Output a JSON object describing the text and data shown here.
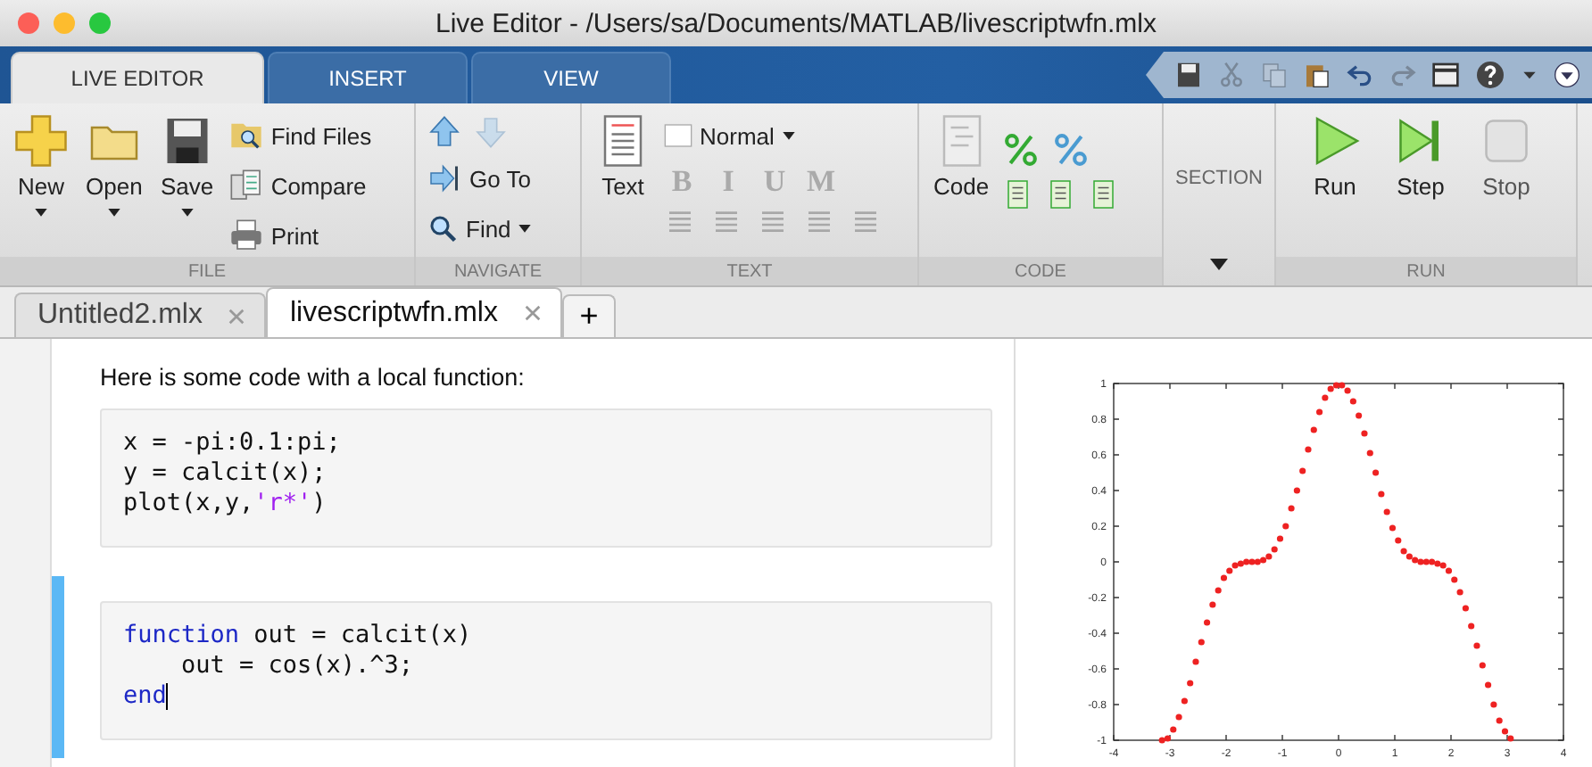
{
  "window": {
    "title": "Live Editor - /Users/sa/Documents/MATLAB/livescriptwfn.mlx"
  },
  "ribbon_tabs": [
    {
      "label": "LIVE EDITOR",
      "selected": true
    },
    {
      "label": "INSERT",
      "selected": false
    },
    {
      "label": "VIEW",
      "selected": false
    }
  ],
  "quick_access": [
    {
      "kind": "save",
      "disabled": false
    },
    {
      "kind": "cut",
      "disabled": true
    },
    {
      "kind": "copy",
      "disabled": true
    },
    {
      "kind": "paste",
      "disabled": false
    },
    {
      "kind": "undo",
      "disabled": false
    },
    {
      "kind": "redo",
      "disabled": true
    },
    {
      "kind": "window",
      "disabled": false
    },
    {
      "kind": "help",
      "disabled": false
    },
    {
      "kind": "caret",
      "disabled": false
    },
    {
      "kind": "menu",
      "disabled": false
    }
  ],
  "file_group": {
    "label": "FILE",
    "large": [
      {
        "kind": "new",
        "label": "New"
      },
      {
        "kind": "open",
        "label": "Open"
      },
      {
        "kind": "save",
        "label": "Save"
      }
    ],
    "small": [
      {
        "kind": "find",
        "label": "Find Files"
      },
      {
        "kind": "compare",
        "label": "Compare"
      },
      {
        "kind": "print",
        "label": "Print"
      }
    ]
  },
  "navigate_group": {
    "label": "NAVIGATE",
    "arrows": [
      {
        "kind": "up",
        "disabled": false
      },
      {
        "kind": "down",
        "disabled": true
      }
    ],
    "go_to": "Go To",
    "find": "Find"
  },
  "text_group": {
    "label": "TEXT",
    "button": "Text",
    "style": "Normal",
    "formats": [
      {
        "label": "B",
        "disabled": true
      },
      {
        "label": "I",
        "disabled": true
      },
      {
        "label": "U",
        "disabled": true
      },
      {
        "label": "M",
        "disabled": true
      }
    ]
  },
  "code_group": {
    "label": "CODE",
    "button": "Code"
  },
  "section_group": {
    "label": "SECTION"
  },
  "run_group": {
    "label": "RUN",
    "buttons": [
      {
        "kind": "run",
        "label": "Run",
        "disabled": false
      },
      {
        "kind": "step",
        "label": "Step",
        "disabled": false
      },
      {
        "kind": "stop",
        "label": "Stop",
        "disabled": true
      }
    ]
  },
  "doc_tabs": [
    {
      "label": "Untitled2.mlx",
      "selected": false
    },
    {
      "label": "livescriptwfn.mlx",
      "selected": true
    }
  ],
  "new_tab": "+",
  "document": {
    "text": "Here is some code with a local function:",
    "blocks": [
      {
        "active": false,
        "lines": [
          [
            {
              "kind": "plain",
              "text": "x = -pi:0.1:pi;"
            }
          ],
          [
            {
              "kind": "plain",
              "text": "y = calcit(x);"
            }
          ],
          [
            {
              "kind": "plain",
              "text": "plot(x,y,"
            },
            {
              "kind": "string",
              "text": "'r*'"
            },
            {
              "kind": "plain",
              "text": ")"
            }
          ]
        ]
      },
      {
        "active": true,
        "lines": [
          [
            {
              "kind": "keyword",
              "text": "function"
            },
            {
              "kind": "plain",
              "text": " out = calcit(x)"
            }
          ],
          [
            {
              "kind": "plain",
              "text": "    out = cos(x).^3;"
            }
          ],
          [
            {
              "kind": "keyword",
              "text": "end"
            }
          ]
        ]
      }
    ]
  },
  "figure": {
    "chart_data": {
      "type": "scatter",
      "xlim": [
        -4,
        4
      ],
      "ylim": [
        -1,
        1
      ],
      "xticks": [
        -4,
        -3,
        -2,
        -1,
        0,
        1,
        2,
        3,
        4
      ],
      "yticks": [
        -1,
        -0.8,
        -0.6,
        -0.4,
        -0.2,
        0,
        0.2,
        0.4,
        0.6,
        0.8,
        1
      ],
      "x": [
        -3.14,
        -3.04,
        -2.94,
        -2.84,
        -2.74,
        -2.64,
        -2.54,
        -2.44,
        -2.34,
        -2.24,
        -2.14,
        -2.04,
        -1.94,
        -1.84,
        -1.74,
        -1.64,
        -1.54,
        -1.44,
        -1.34,
        -1.24,
        -1.14,
        -1.04,
        -0.94,
        -0.84,
        -0.74,
        -0.64,
        -0.54,
        -0.44,
        -0.34,
        -0.24,
        -0.14,
        -0.04,
        0.06,
        0.16,
        0.26,
        0.36,
        0.46,
        0.56,
        0.66,
        0.76,
        0.86,
        0.96,
        1.06,
        1.16,
        1.26,
        1.36,
        1.46,
        1.56,
        1.66,
        1.76,
        1.86,
        1.96,
        2.06,
        2.16,
        2.26,
        2.36,
        2.46,
        2.56,
        2.66,
        2.76,
        2.86,
        2.96,
        3.06
      ],
      "series": [
        {
          "color": "#ee2222",
          "values": [
            -1,
            -0.99,
            -0.94,
            -0.87,
            -0.78,
            -0.68,
            -0.56,
            -0.45,
            -0.34,
            -0.24,
            -0.16,
            -0.09,
            -0.05,
            -0.02,
            -0.01,
            0,
            0,
            0,
            0.01,
            0.03,
            0.07,
            0.13,
            0.2,
            0.3,
            0.4,
            0.51,
            0.63,
            0.74,
            0.84,
            0.92,
            0.97,
            0.99,
            0.99,
            0.96,
            0.9,
            0.82,
            0.72,
            0.61,
            0.5,
            0.38,
            0.28,
            0.19,
            0.12,
            0.06,
            0.03,
            0.01,
            0,
            0,
            0,
            -0.01,
            -0.02,
            -0.05,
            -0.1,
            -0.17,
            -0.26,
            -0.36,
            -0.47,
            -0.58,
            -0.69,
            -0.8,
            -0.89,
            -0.95,
            -0.99
          ]
        }
      ]
    }
  }
}
